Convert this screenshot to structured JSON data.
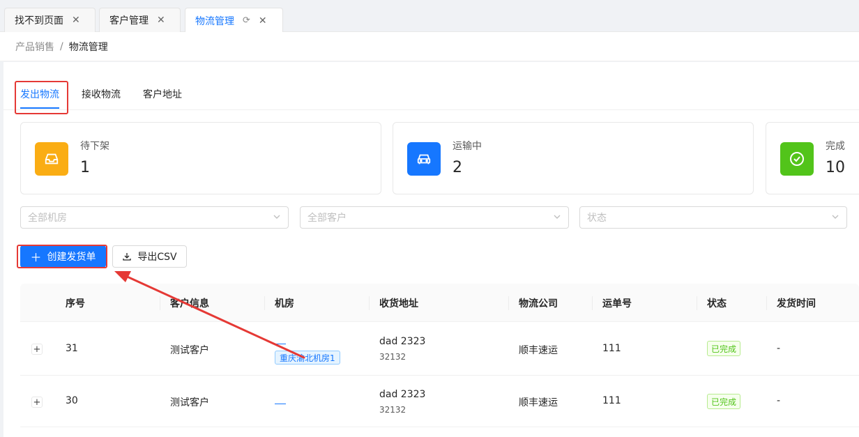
{
  "tabs": [
    {
      "label": "找不到页面",
      "active": false
    },
    {
      "label": "客户管理",
      "active": false
    },
    {
      "label": "物流管理",
      "active": true
    }
  ],
  "breadcrumb": {
    "parent": "产品销售",
    "separator": "/",
    "current": "物流管理"
  },
  "subtabs": [
    {
      "label": "发出物流",
      "active": true
    },
    {
      "label": "接收物流",
      "active": false
    },
    {
      "label": "客户地址",
      "active": false
    }
  ],
  "stats": [
    {
      "label": "待下架",
      "value": "1",
      "color": "#faad14",
      "icon": "inbox-icon"
    },
    {
      "label": "运输中",
      "value": "2",
      "color": "#1677ff",
      "icon": "car-icon"
    },
    {
      "label": "完成",
      "value": "10",
      "color": "#52c41a",
      "icon": "check-circle-icon"
    }
  ],
  "filters": {
    "room_placeholder": "全部机房",
    "customer_placeholder": "全部客户",
    "status_placeholder": "状态"
  },
  "toolbar": {
    "create_label": "创建发货单",
    "export_label": "导出CSV"
  },
  "table": {
    "columns": [
      "序号",
      "客户信息",
      "机房",
      "收货地址",
      "物流公司",
      "运单号",
      "状态",
      "发货时间"
    ],
    "rows": [
      {
        "id": "31",
        "customer": "测试客户",
        "room_tag": "重庆渝北机房1",
        "address": "dad 2323",
        "address_sub": "32132",
        "company": "顺丰速运",
        "tracking": "111",
        "status": "已完成",
        "ship_time": "-"
      },
      {
        "id": "30",
        "customer": "测试客户",
        "room_tag": "",
        "address": "dad 2323",
        "address_sub": "32132",
        "company": "顺丰速运",
        "tracking": "111",
        "status": "已完成",
        "ship_time": "-"
      }
    ]
  },
  "colors": {
    "primary": "#1677ff",
    "annotation": "#e53935"
  }
}
